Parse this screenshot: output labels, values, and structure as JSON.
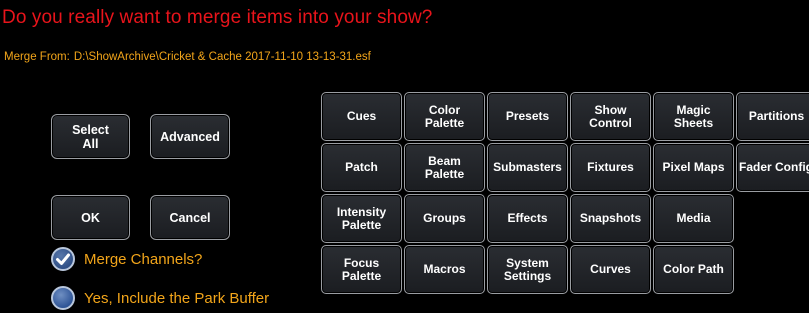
{
  "dialog": {
    "title": "Do you really want to merge items into your show?",
    "merge_from_label": "Merge From:",
    "merge_from_path": "D:\\ShowArchive\\Cricket & Cache 2017-11-10 13-13-31.esf"
  },
  "buttons": {
    "select_all": "Select\nAll",
    "advanced": "Advanced",
    "ok": "OK",
    "cancel": "Cancel"
  },
  "options": {
    "merge_channels": {
      "label": "Merge Channels?",
      "checked": true
    },
    "park_buffer": {
      "label": "Yes, Include the Park Buffer",
      "checked": false
    }
  },
  "categories": [
    "Cues",
    "Color\nPalette",
    "Presets",
    "Show\nControl",
    "Magic\nSheets",
    "Partitions",
    "Patch",
    "Beam\nPalette",
    "Submasters",
    "Fixtures",
    "Pixel Maps",
    "Fader Configs",
    "Intensity\nPalette",
    "Groups",
    "Effects",
    "Snapshots",
    "Media",
    "",
    "Focus\nPalette",
    "Macros",
    "System\nSettings",
    "Curves",
    "Color Path",
    ""
  ],
  "icons": {
    "checkmark": "check-icon"
  },
  "colors": {
    "title": "#e8141b",
    "accent_text": "#f2a51a",
    "checkbox_fill": "#2f5597"
  }
}
